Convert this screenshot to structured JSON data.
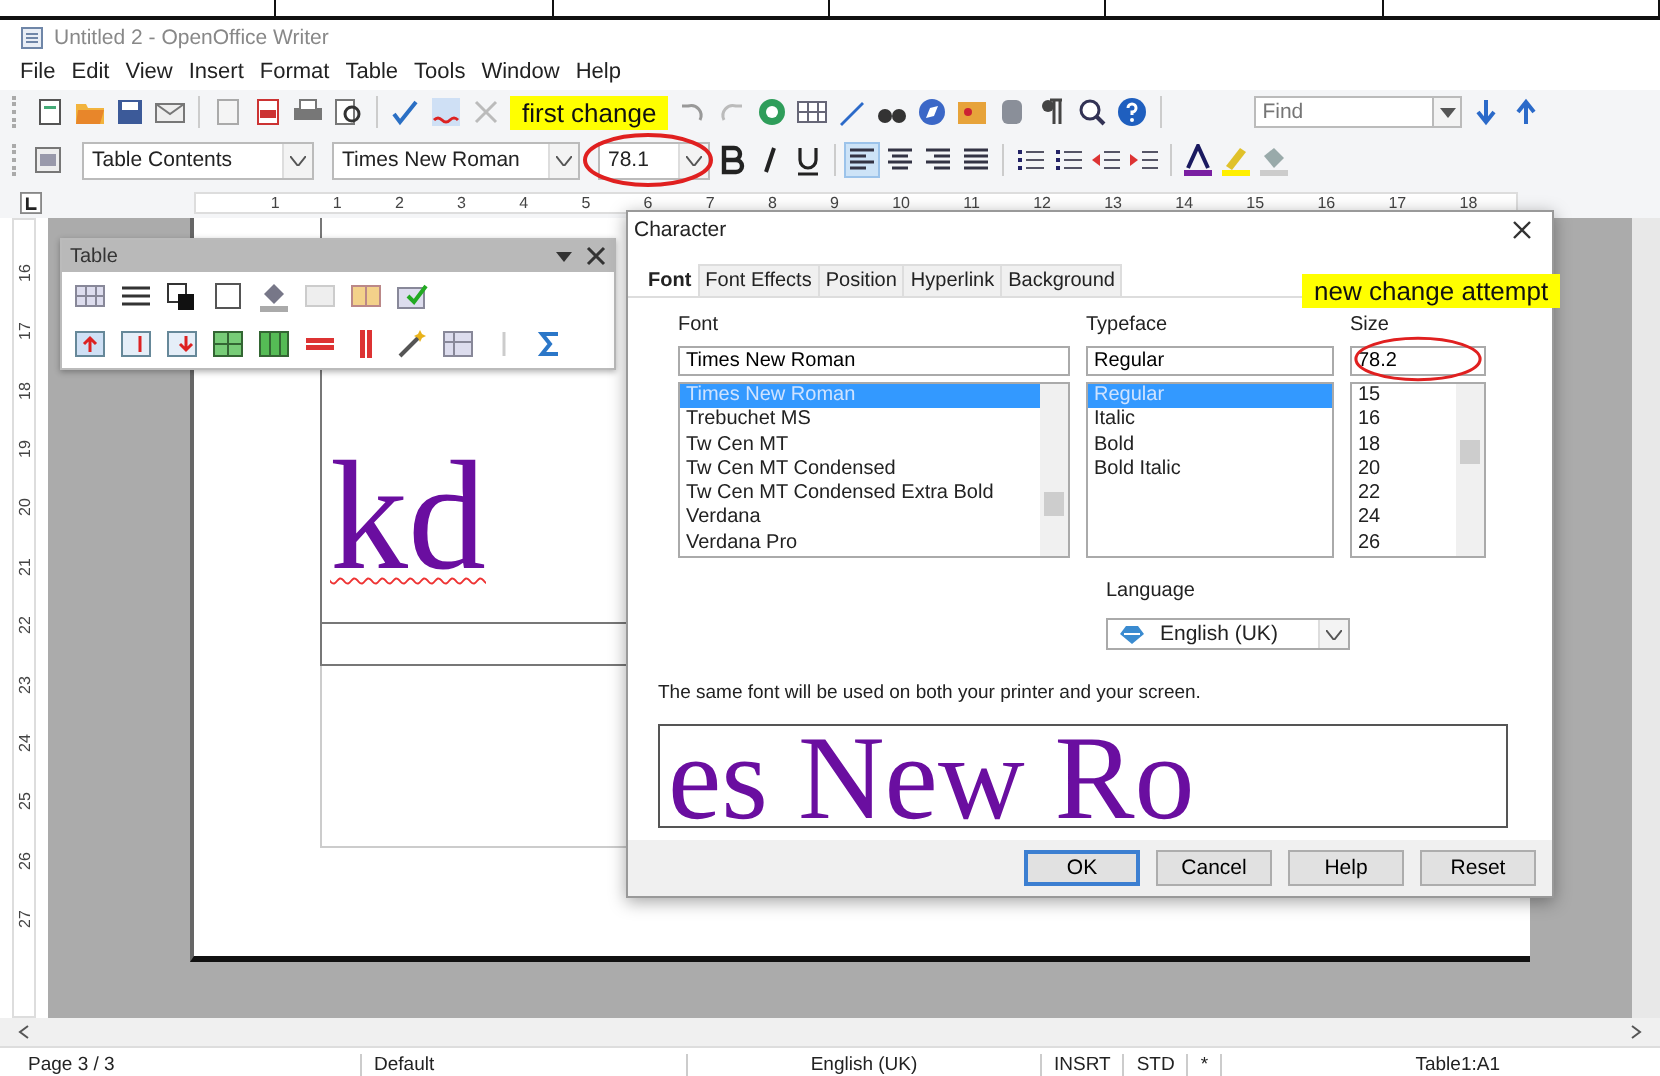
{
  "window": {
    "title": "Untitled 2 - OpenOffice Writer"
  },
  "menu": [
    "File",
    "Edit",
    "View",
    "Insert",
    "Format",
    "Table",
    "Tools",
    "Window",
    "Help"
  ],
  "standard_toolbar": {
    "annotation": "first change",
    "find": {
      "placeholder": "Find"
    }
  },
  "formatting_toolbar": {
    "paragraph_style": "Table Contents",
    "font_name": "Times New Roman",
    "font_size": "78.1",
    "size_circled": true,
    "alignment": [
      {
        "selected": true
      },
      {
        "selected": false
      },
      {
        "selected": false
      },
      {
        "selected": false
      }
    ]
  },
  "horizontal_ruler": [
    "1",
    "1",
    "2",
    "3",
    "4",
    "5",
    "6",
    "7",
    "8",
    "9",
    "10",
    "11",
    "12",
    "13",
    "14",
    "15",
    "16",
    "17",
    "18"
  ],
  "vertical_ruler": [
    "16",
    "17",
    "18",
    "19",
    "20",
    "21",
    "22",
    "23",
    "24",
    "25",
    "26",
    "27"
  ],
  "document": {
    "text": "kd"
  },
  "table_toolbar": {
    "title": "Table"
  },
  "dialog": {
    "title": "Character",
    "tabs": [
      {
        "label": "Font",
        "selected": true
      },
      {
        "label": "Font Effects",
        "selected": false
      },
      {
        "label": "Position",
        "selected": false
      },
      {
        "label": "Hyperlink",
        "selected": false
      },
      {
        "label": "Background",
        "selected": false
      }
    ],
    "font": {
      "label": "Font",
      "value": "Times New Roman",
      "options": [
        {
          "label": "Times New Roman",
          "selected": true
        },
        {
          "label": "Trebuchet MS",
          "selected": false
        },
        {
          "label": "Tw Cen MT",
          "selected": false
        },
        {
          "label": "Tw Cen MT Condensed",
          "selected": false
        },
        {
          "label": "Tw Cen MT Condensed Extra Bold",
          "selected": false
        },
        {
          "label": "Verdana",
          "selected": false
        },
        {
          "label": "Verdana Pro",
          "selected": false
        }
      ]
    },
    "typeface": {
      "label": "Typeface",
      "value": "Regular",
      "options": [
        {
          "label": "Regular",
          "selected": true
        },
        {
          "label": "Italic",
          "selected": false
        },
        {
          "label": "Bold",
          "selected": false
        },
        {
          "label": "Bold Italic",
          "selected": false
        }
      ]
    },
    "size": {
      "label": "Size",
      "value": "78.2",
      "circled": true,
      "annotation": "new change attempt",
      "options": [
        {
          "label": "15",
          "selected": false
        },
        {
          "label": "16",
          "selected": false
        },
        {
          "label": "18",
          "selected": false
        },
        {
          "label": "20",
          "selected": false
        },
        {
          "label": "22",
          "selected": false
        },
        {
          "label": "24",
          "selected": false
        },
        {
          "label": "26",
          "selected": false
        }
      ]
    },
    "language": {
      "label": "Language",
      "value": "English (UK)"
    },
    "note": "The same font will be used on both your printer and your screen.",
    "preview": "es New Ro",
    "buttons": [
      {
        "label": "OK",
        "default": true
      },
      {
        "label": "Cancel",
        "default": false
      },
      {
        "label": "Help",
        "default": false
      },
      {
        "label": "Reset",
        "default": false
      }
    ]
  },
  "status_bar": [
    "Page 3 / 3",
    "Default",
    "English (UK)",
    "INSRT",
    "STD",
    "*",
    "Table1:A1"
  ]
}
